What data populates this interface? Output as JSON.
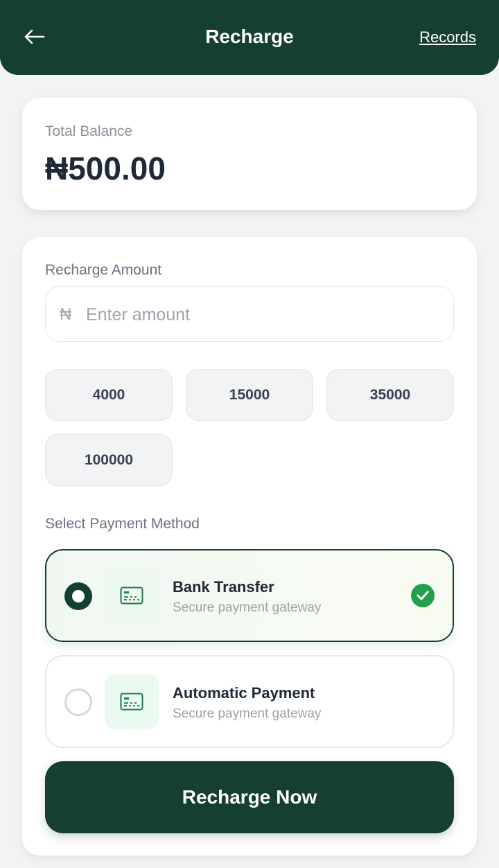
{
  "header": {
    "title": "Recharge",
    "records_label": "Records",
    "back_icon": "arrow-left-icon"
  },
  "balance": {
    "label": "Total Balance",
    "value": "₦500.00"
  },
  "recharge": {
    "amount_label": "Recharge Amount",
    "currency_symbol": "₦",
    "amount_placeholder": "Enter amount",
    "amount_value": "",
    "quick_amounts": [
      "4000",
      "15000",
      "35000",
      "100000"
    ]
  },
  "payment": {
    "section_label": "Select Payment Method",
    "methods": [
      {
        "name": "Bank Transfer",
        "subtitle": "Secure payment gateway",
        "selected": true,
        "icon": "card-icon"
      },
      {
        "name": "Automatic Payment",
        "subtitle": "Secure payment gateway",
        "selected": false,
        "icon": "card-icon"
      }
    ]
  },
  "submit": {
    "label": "Recharge Now"
  },
  "colors": {
    "primary": "#153f31",
    "success": "#22a04b",
    "background": "#f1f3f4"
  }
}
